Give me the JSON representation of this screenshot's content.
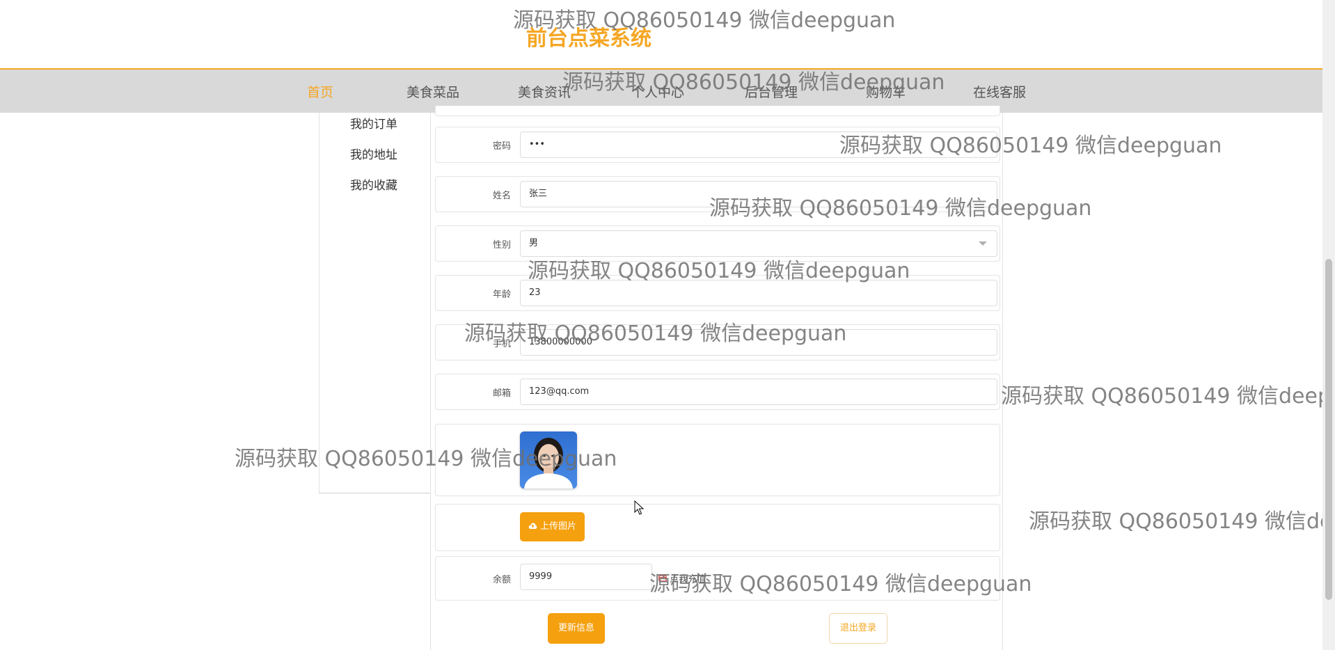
{
  "site": {
    "title": "前台点菜系统"
  },
  "nav": {
    "items": [
      "首页",
      "美食菜品",
      "美食资讯",
      "个人中心",
      "后台管理",
      "购物车",
      "在线客服"
    ]
  },
  "sidebar": {
    "items": [
      "我的订单",
      "我的地址",
      "我的收藏"
    ]
  },
  "form": {
    "password": {
      "label": "密码",
      "value": "•••"
    },
    "name": {
      "label": "姓名",
      "value": "张三"
    },
    "gender": {
      "label": "性别",
      "value": "男"
    },
    "age": {
      "label": "年龄",
      "value": "23"
    },
    "phone": {
      "label": "手机",
      "value": "13800000000"
    },
    "email": {
      "label": "邮箱",
      "value": "123@qq.com"
    },
    "upload_label": "上传图片",
    "balance": {
      "label": "余额",
      "value": "9999",
      "recharge_label": "点我充值"
    },
    "update_label": "更新信息",
    "logout_label": "退出登录"
  },
  "watermark": "源码获取 QQ86050149 微信deepguan",
  "colors": {
    "accent": "#f5a623",
    "nav_bg": "#d9d9d9"
  },
  "icons": {
    "upload": "cloud-upload-icon",
    "recharge": "card-icon",
    "select": "chevron-down-icon"
  }
}
